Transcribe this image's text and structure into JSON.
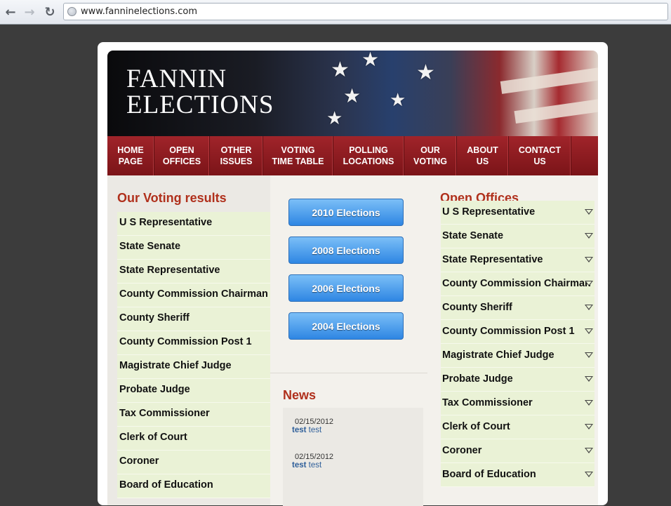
{
  "browser": {
    "url": "www.fanninelections.com",
    "back_glyph": "←",
    "forward_glyph": "→",
    "reload_glyph": "↻"
  },
  "site": {
    "title_line1": "FANNIN",
    "title_line2": "ELECTIONS",
    "accent_color": "#b0301c",
    "nav_color": "#8b1a1f"
  },
  "nav": [
    {
      "label": "HOME\nPAGE"
    },
    {
      "label": "OPEN\nOFFICES"
    },
    {
      "label": "OTHER\nISSUES"
    },
    {
      "label": "VOTING\nTIME TABLE"
    },
    {
      "label": "POLLING\nLOCATIONS"
    },
    {
      "label": "OUR\nVOTING"
    },
    {
      "label": "ABOUT\nUS"
    },
    {
      "label": "CONTACT\nUS"
    }
  ],
  "voting_results": {
    "heading": "Our Voting results",
    "items": [
      "U S Representative",
      "State Senate",
      "State Representative",
      "County Commission Chairman",
      "County Sheriff",
      "County Commission Post 1",
      "Magistrate Chief Judge",
      "Probate Judge",
      "Tax Commissioner",
      "Clerk of Court",
      "Coroner",
      "Board of Education"
    ]
  },
  "elections": [
    "2010 Elections",
    "2008 Elections",
    "2006 Elections",
    "2004 Elections"
  ],
  "news": {
    "heading": "News",
    "items": [
      {
        "date": "02/15/2012",
        "title": "test",
        "text": "test"
      },
      {
        "date": "02/15/2012",
        "title": "test",
        "text": "test"
      }
    ]
  },
  "open_offices": {
    "heading": "Open Offices",
    "items": [
      "U S Representative",
      "State Senate",
      "State Representative",
      "County Commission Chairman",
      "County Sheriff",
      "County Commission Post 1",
      "Magistrate Chief Judge",
      "Probate Judge",
      "Tax Commissioner",
      "Clerk of Court",
      "Coroner",
      "Board of Education"
    ]
  }
}
